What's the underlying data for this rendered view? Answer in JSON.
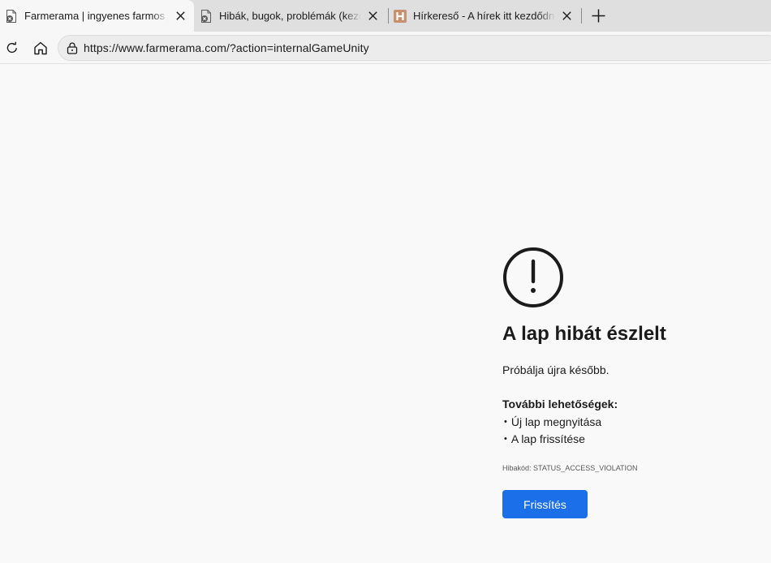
{
  "browser": {
    "tabs": [
      {
        "title": "Farmerama | ingyenes farmos játék",
        "favicon": "crashed-page-icon",
        "active": true
      },
      {
        "title": "Hibák, bugok, problémák (kezdők",
        "favicon": "crashed-page-icon",
        "active": false
      },
      {
        "title": "Hírkereső - A hírek itt kezdődnek!",
        "favicon": "h-logo-icon",
        "active": false
      }
    ],
    "new_tab_icon": "plus-icon",
    "close_icon": "close-icon"
  },
  "toolbar": {
    "refresh_icon": "refresh-icon",
    "home_icon": "home-icon",
    "lock_icon": "lock-icon",
    "url": "https://www.farmerama.com/?action=internalGameUnity"
  },
  "error_page": {
    "icon": "exclamation-circle-icon",
    "title": "A lap hibát észlelt",
    "message": "Próbálja újra később.",
    "options_heading": "További lehetőségek:",
    "options": [
      "Új lap megnyitása",
      "A lap frissítése"
    ],
    "error_code": "Hibakód: STATUS_ACCESS_VIOLATION",
    "reload_button": "Frissítés",
    "accent_color": "#1b6fe8"
  }
}
